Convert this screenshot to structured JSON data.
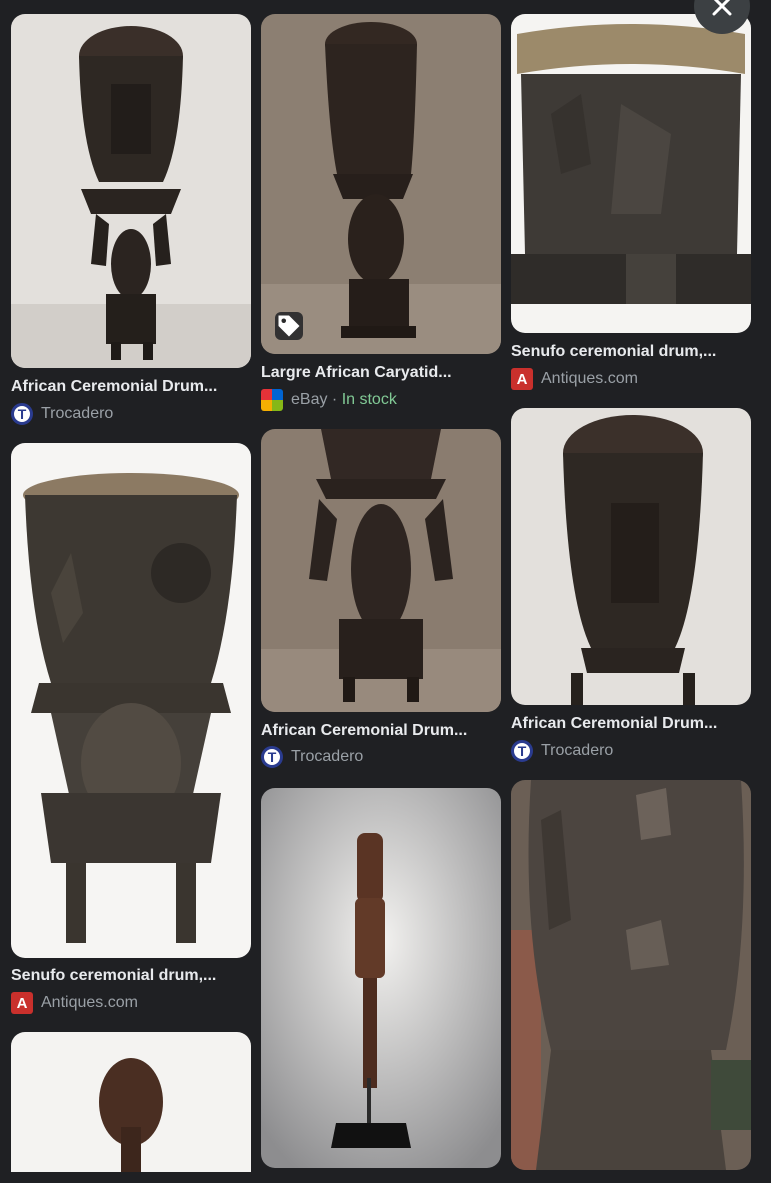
{
  "close_icon": "close-icon",
  "results": [
    {
      "title": "African Ceremonial Drum...",
      "source": "Trocadero",
      "favicon": "T"
    },
    {
      "title": "Senufo ceremonial drum,...",
      "source": "Antiques.com",
      "favicon": "A"
    },
    {
      "title": "Largre African Caryatid...",
      "source": "eBay",
      "separator": " · ",
      "stock": "In stock",
      "favicon": "ebay-icon"
    },
    {
      "title": "African Ceremonial Drum...",
      "source": "Trocadero",
      "favicon": "T"
    },
    {
      "title": "Senufo ceremonial drum,...",
      "source": "Antiques.com",
      "favicon": "A"
    },
    {
      "title": "African Ceremonial Drum...",
      "source": "Trocadero",
      "favicon": "T"
    }
  ],
  "colors": {
    "background": "#1f2023",
    "title": "#e8eaed",
    "source": "#9aa0a6",
    "stock": "#81c995"
  }
}
